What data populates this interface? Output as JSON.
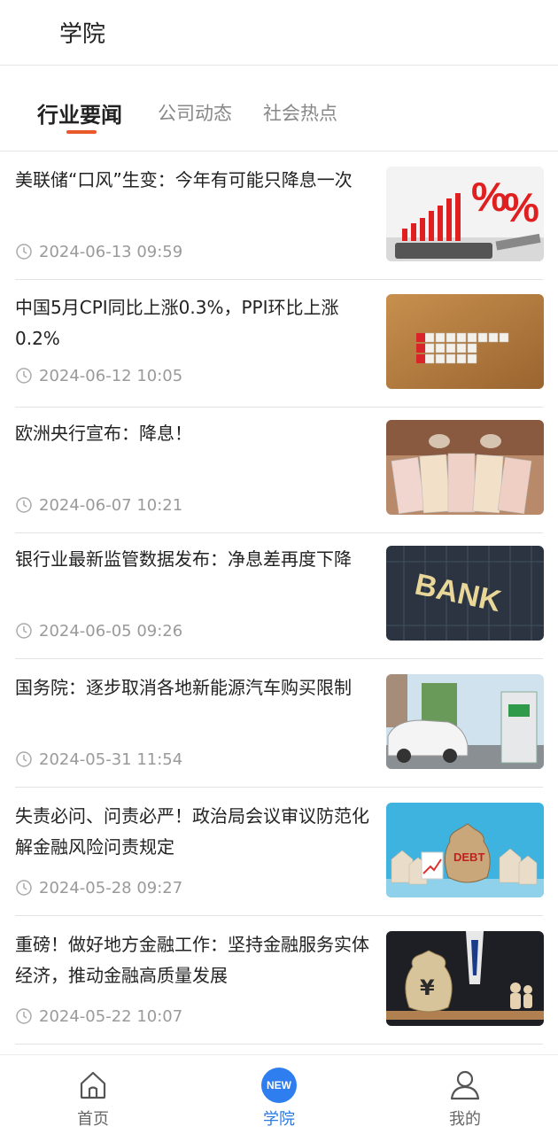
{
  "header": {
    "title": "学院"
  },
  "tabs": [
    {
      "label": "行业要闻",
      "active": true
    },
    {
      "label": "公司动态",
      "active": false
    },
    {
      "label": "社会热点",
      "active": false
    }
  ],
  "colors": {
    "accent": "#e85a2a",
    "nav_active": "#2a7ae2",
    "badge": "#2f7ef0"
  },
  "news": [
    {
      "title": "美联储“口风”生变：今年有可能只降息一次",
      "time": "2024-06-13 09:59",
      "image": "percent-chart-image"
    },
    {
      "title": "中国5月CPI同比上涨0.3%，PPI环比上涨0.2%",
      "time": "2024-06-12 10:05",
      "image": "cpi-dice-image"
    },
    {
      "title": "欧洲央行宣布：降息！",
      "time": "2024-06-07 10:21",
      "image": "euro-banknotes-image"
    },
    {
      "title": "银行业最新监管数据发布：净息差再度下降",
      "time": "2024-06-05 09:26",
      "image": "bank-building-image"
    },
    {
      "title": "国务院：逐步取消各地新能源汽车购买限制",
      "time": "2024-05-31 11:54",
      "image": "ev-charging-image"
    },
    {
      "title": "失责必问、问责必严！政治局会议审议防范化解金融风险问责规定",
      "time": "2024-05-28 09:27",
      "image": "debt-houses-image"
    },
    {
      "title": "重磅！做好地方金融工作：坚持金融服务实体经济，推动金融高质量发展",
      "time": "2024-05-22 10:07",
      "image": "yuan-bag-image"
    }
  ],
  "bottom_nav": [
    {
      "label": "首页",
      "icon": "home-icon",
      "active": false
    },
    {
      "label": "学院",
      "icon": "new-badge",
      "badge": "NEW",
      "active": true
    },
    {
      "label": "我的",
      "icon": "user-icon",
      "active": false
    }
  ]
}
